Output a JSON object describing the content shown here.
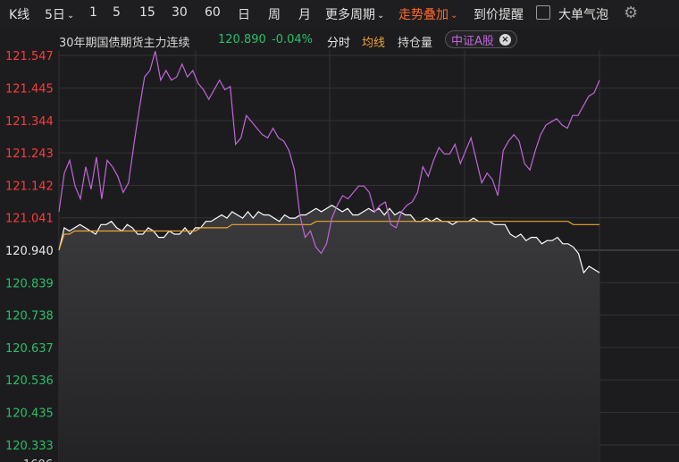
{
  "toolbar": {
    "k_line": "K线",
    "period_5d": "5日",
    "p1": "1",
    "p5": "5",
    "p15": "15",
    "p30": "30",
    "p60": "60",
    "day": "日",
    "week": "周",
    "month": "月",
    "more_periods": "更多周期",
    "trend_overlay": "走势叠加",
    "price_alert": "到价提醒",
    "big_order_bubble": "大单气泡",
    "settings_icon": "gear-icon"
  },
  "info": {
    "instrument": "30年期国债期货主力连续",
    "price": "120.890",
    "change_pct": "-0.04%",
    "timeshare": "分时",
    "avg_line": "均线",
    "open_interest": "持仓量",
    "overlay_tag": "中证A股",
    "close_icon": "close-icon"
  },
  "colors": {
    "up": "#ff3a3a",
    "down": "#26c06a",
    "neutral": "#e8e8e8",
    "price_line": "#ffffff",
    "avg_line": "#f0a22e",
    "overlay_line": "#c066d8",
    "accent": "#ff6a2a"
  },
  "chart_data": {
    "type": "line",
    "y_ticks": [
      "121.547",
      "121.445",
      "121.344",
      "121.243",
      "121.142",
      "121.041",
      "120.940",
      "120.839",
      "120.738",
      "120.637",
      "120.536",
      "120.435",
      "120.333"
    ],
    "bottom_label_partial": "1606",
    "ylim": [
      120.333,
      121.547
    ],
    "prev_close": 120.94,
    "sessions": 2,
    "grid": true,
    "series": [
      {
        "name": "30年期国债期货主力连续",
        "values": [
          120.94,
          121.01,
          121.0,
          121.01,
          121.02,
          121.01,
          121.0,
          120.99,
          121.02,
          121.02,
          121.03,
          121.01,
          121.0,
          121.02,
          121.01,
          120.99,
          120.99,
          121.01,
          121.0,
          120.98,
          120.98,
          121.0,
          120.99,
          120.99,
          121.01,
          120.99,
          121.01,
          121.01,
          121.03,
          121.03,
          121.04,
          121.05,
          121.04,
          121.06,
          121.05,
          121.04,
          121.06,
          121.04,
          121.06,
          121.05,
          121.05,
          121.04,
          121.03,
          121.05,
          121.04,
          121.04,
          121.05,
          121.05,
          121.06,
          121.07,
          121.06,
          121.07,
          121.08,
          121.07,
          121.06,
          121.07,
          121.05,
          121.05,
          121.06,
          121.07,
          121.06,
          121.07,
          121.05,
          121.07,
          121.05,
          121.06,
          121.05,
          121.05,
          121.03,
          121.03,
          121.04,
          121.03,
          121.04,
          121.03,
          121.03,
          121.02,
          121.03,
          121.03,
          121.03,
          121.04,
          121.03,
          121.03,
          121.03,
          121.02,
          121.02,
          121.02,
          120.99,
          120.98,
          120.99,
          120.97,
          120.98,
          120.98,
          120.96,
          120.97,
          120.97,
          120.98,
          120.96,
          120.96,
          120.95,
          120.93,
          120.87,
          120.89,
          120.88,
          120.87
        ],
        "color": "#ffffff"
      },
      {
        "name": "均线",
        "values": [
          120.94,
          120.99,
          120.99,
          121.0,
          121.0,
          121.0,
          121.0,
          121.0,
          121.0,
          121.0,
          121.0,
          121.0,
          121.0,
          121.0,
          121.0,
          121.0,
          121.0,
          121.0,
          121.0,
          121.0,
          121.0,
          121.0,
          121.0,
          121.0,
          121.0,
          121.0,
          121.0,
          121.01,
          121.01,
          121.01,
          121.01,
          121.01,
          121.01,
          121.02,
          121.02,
          121.02,
          121.02,
          121.02,
          121.02,
          121.02,
          121.02,
          121.02,
          121.02,
          121.02,
          121.02,
          121.02,
          121.02,
          121.02,
          121.02,
          121.03,
          121.03,
          121.03,
          121.03,
          121.03,
          121.03,
          121.03,
          121.03,
          121.03,
          121.03,
          121.03,
          121.03,
          121.03,
          121.03,
          121.03,
          121.03,
          121.03,
          121.03,
          121.03,
          121.03,
          121.03,
          121.03,
          121.03,
          121.03,
          121.03,
          121.03,
          121.03,
          121.03,
          121.03,
          121.03,
          121.03,
          121.03,
          121.03,
          121.03,
          121.03,
          121.03,
          121.03,
          121.03,
          121.03,
          121.03,
          121.03,
          121.03,
          121.03,
          121.03,
          121.03,
          121.03,
          121.03,
          121.03,
          121.03,
          121.02,
          121.02,
          121.02,
          121.02,
          121.02,
          121.02
        ],
        "color": "#f0a22e"
      },
      {
        "name": "中证A股",
        "values": [
          121.06,
          121.18,
          121.22,
          121.14,
          121.1,
          121.2,
          121.13,
          121.23,
          121.1,
          121.22,
          121.2,
          121.17,
          121.12,
          121.15,
          121.27,
          121.38,
          121.48,
          121.5,
          121.56,
          121.47,
          121.5,
          121.47,
          121.48,
          121.52,
          121.48,
          121.5,
          121.46,
          121.44,
          121.41,
          121.44,
          121.47,
          121.44,
          121.45,
          121.27,
          121.29,
          121.36,
          121.34,
          121.32,
          121.3,
          121.29,
          121.32,
          121.29,
          121.28,
          121.25,
          121.19,
          121.05,
          120.98,
          121.0,
          120.95,
          120.93,
          120.96,
          121.04,
          121.08,
          121.11,
          121.1,
          121.12,
          121.14,
          121.14,
          121.12,
          121.06,
          121.08,
          121.09,
          121.02,
          121.01,
          121.06,
          121.08,
          121.09,
          121.12,
          121.2,
          121.17,
          121.22,
          121.26,
          121.24,
          121.24,
          121.27,
          121.21,
          121.25,
          121.29,
          121.22,
          121.15,
          121.18,
          121.16,
          121.11,
          121.25,
          121.28,
          121.3,
          121.28,
          121.21,
          121.19,
          121.25,
          121.3,
          121.33,
          121.34,
          121.35,
          121.33,
          121.32,
          121.36,
          121.36,
          121.39,
          121.42,
          121.43,
          121.47
        ],
        "color": "#c066d8"
      }
    ]
  }
}
